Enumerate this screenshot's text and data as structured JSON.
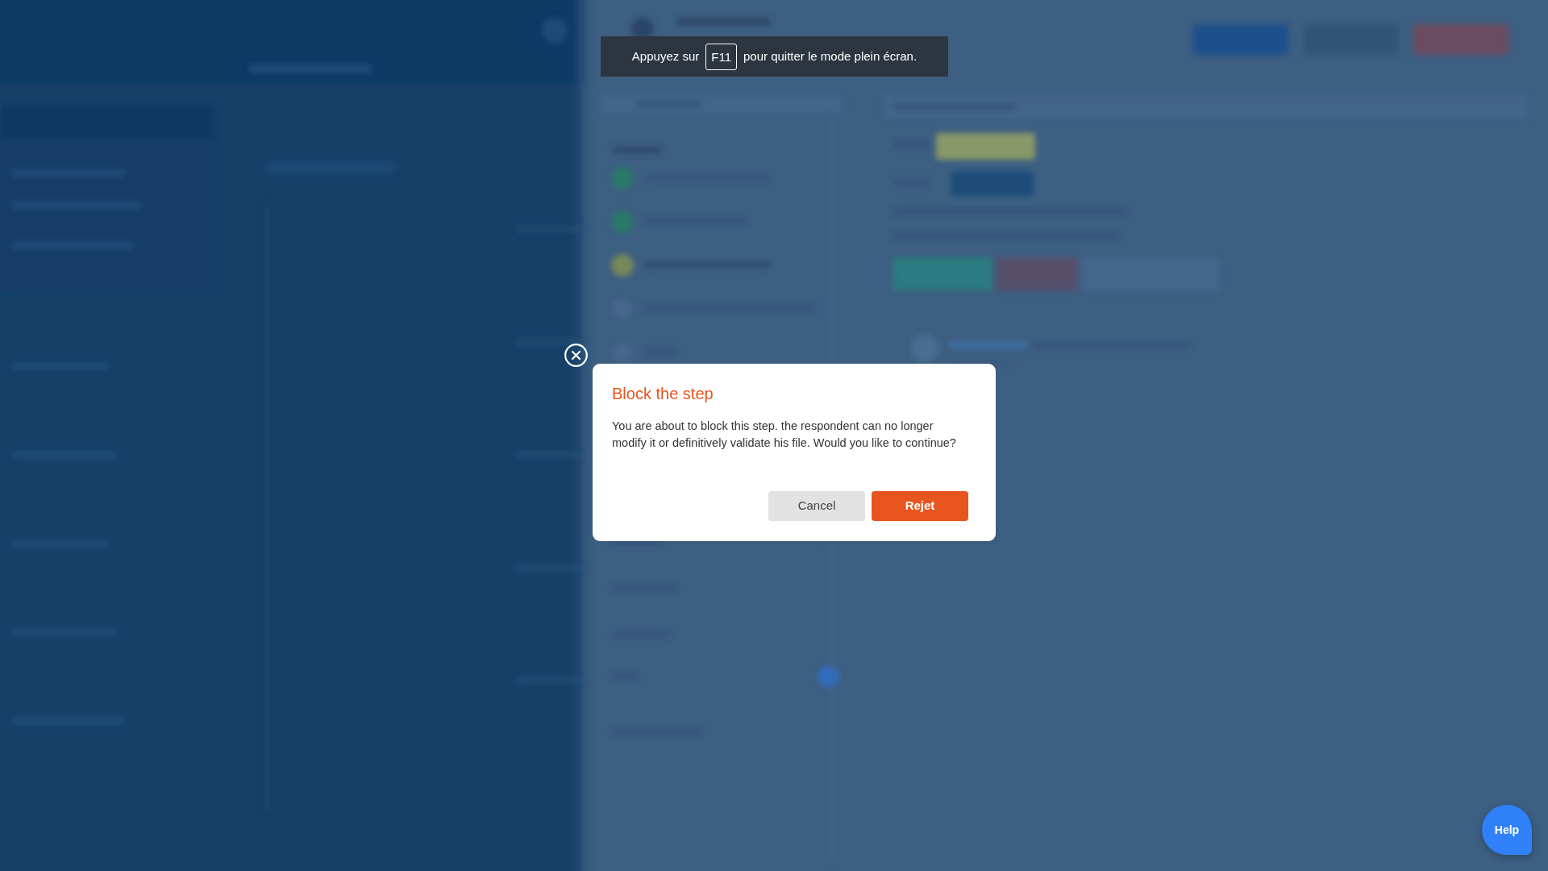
{
  "fullscreen_notice": {
    "before": "Appuyez sur",
    "key": "F11",
    "after": "pour quitter le mode plein écran."
  },
  "dialog": {
    "title": "Block the step",
    "message": "You are about to block this step. the respondent can no longer modify it or definitively validate his file. Would you like to continue?",
    "buttons": [
      {
        "label": "Cancel",
        "kind": "secondary"
      },
      {
        "label": "Rejet",
        "kind": "primary"
      }
    ]
  },
  "help_button": {
    "label": "Help"
  }
}
